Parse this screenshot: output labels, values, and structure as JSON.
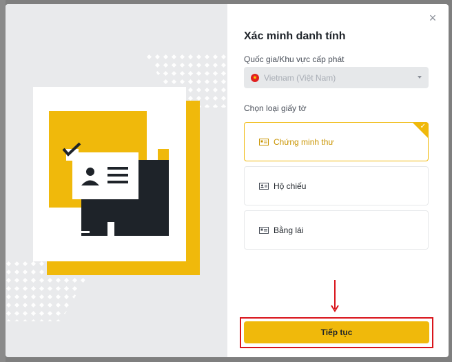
{
  "dialog": {
    "title": "Xác minh danh tính",
    "close_icon": "close-icon"
  },
  "country": {
    "label": "Quốc gia/Khu vực cấp phát",
    "value": "Vietnam (Việt Nam)",
    "flag_icon": "vietnam-flag-icon",
    "flag_glyph": "★"
  },
  "document_type": {
    "label": "Chọn loại giấy tờ",
    "options": [
      {
        "label": "Chứng minh thư",
        "icon": "id-card-icon",
        "selected": true
      },
      {
        "label": "Hộ chiếu",
        "icon": "passport-icon",
        "selected": false
      },
      {
        "label": "Bằng lái",
        "icon": "driver-license-icon",
        "selected": false
      }
    ],
    "check_glyph": "✓"
  },
  "actions": {
    "continue_label": "Tiếp tục"
  },
  "close_glyph": "×",
  "colors": {
    "accent": "#f0b90b",
    "annotation_red": "#d9141b",
    "text": "#1e2329"
  }
}
